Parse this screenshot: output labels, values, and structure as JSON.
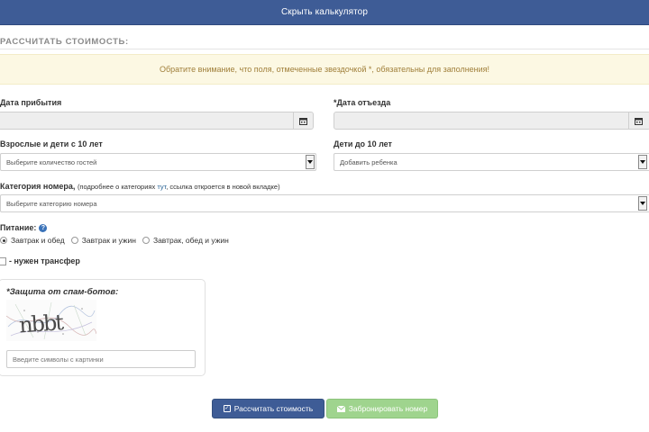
{
  "topbar": {
    "label": "Скрыть калькулятор"
  },
  "section_title": "РАССЧИТАТЬ СТОИМОСТЬ:",
  "notice": "Обратите внимание, что поля, отмеченные звездочкой *, обязательны для заполнения!",
  "arrival": {
    "label": "Дата прибытия",
    "value": ""
  },
  "departure": {
    "label": "*Дата отъезда",
    "value": ""
  },
  "adults": {
    "label": "Взрослые и дети с 10 лет",
    "selected": "Выберите количество гостей"
  },
  "children": {
    "label": "Дети до 10 лет",
    "selected": "Добавить ребенка"
  },
  "room": {
    "label": "Категория номера,",
    "hint_before": "(подробнее о категориях ",
    "hint_link": "тут",
    "hint_after": ", ссылка откроется в новой вкладке)",
    "selected": "Выберите категорию номера"
  },
  "meals": {
    "label": "Питание:",
    "options": [
      "Завтрак и обед",
      "Завтрак и ужин",
      "Завтрак, обед и ужин"
    ],
    "selected_index": 0
  },
  "transfer": {
    "label": "- нужен трансфер",
    "checked": false
  },
  "captcha": {
    "title": "*Защита от спам-ботов:",
    "image_text": "nbbt",
    "placeholder": "Введите символы с картинки"
  },
  "buttons": {
    "calculate": "Рассчитать стоимость",
    "book": "Забронировать номер"
  },
  "colors": {
    "primary": "#3e5c96",
    "success": "#9fd48e",
    "notice_bg": "#fcf8e3",
    "notice_text": "#a07f3a"
  },
  "icons": [
    "calendar-icon",
    "help-icon",
    "checkbox-icon",
    "envelope-icon"
  ]
}
